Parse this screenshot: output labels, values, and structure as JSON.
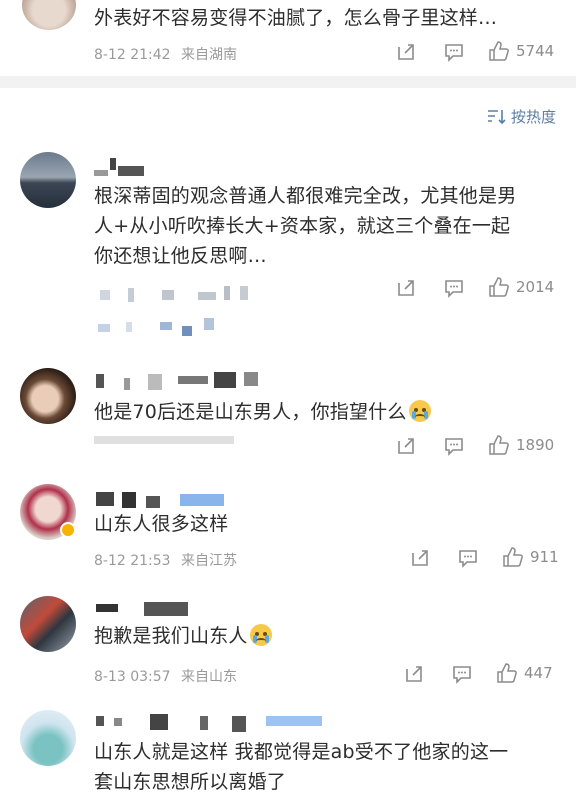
{
  "comments": [
    {
      "text": "外表好不容易变得不油腻了，怎么骨子里这样…",
      "date": "8-12 21:42",
      "location": "来自湖南",
      "likes": "5744"
    },
    {
      "text_line1": "根深蒂固的观念普通人都很难完全改，尤其他是男",
      "text_line2": "人+从小听吹捧长大+资本家，就这三个叠在一起",
      "text_line3": "你还想让他反思啊…",
      "likes": "2014"
    },
    {
      "text": "他是70后还是山东男人，你指望什么",
      "likes": "1890"
    },
    {
      "text": "山东人很多这样",
      "date": "8-12 21:53",
      "location": "来自江苏",
      "likes": "911"
    },
    {
      "text": "抱歉是我们山东人",
      "date": "8-13 03:57",
      "location": "来自山东",
      "likes": "447"
    },
    {
      "text_line1": "山东人就是这样 我都觉得是ab受不了他家的这一",
      "text_line2": "套山东思想所以离婚了"
    }
  ],
  "sort": {
    "label": "按热度"
  },
  "icons": {
    "share": "share-icon",
    "comment": "comment-icon",
    "like": "thumbs-up-icon",
    "sort": "sort-icon"
  },
  "colors": {
    "link": "#5b7ea6",
    "meta": "#9a9a9a",
    "divider": "#f2f2f2"
  }
}
